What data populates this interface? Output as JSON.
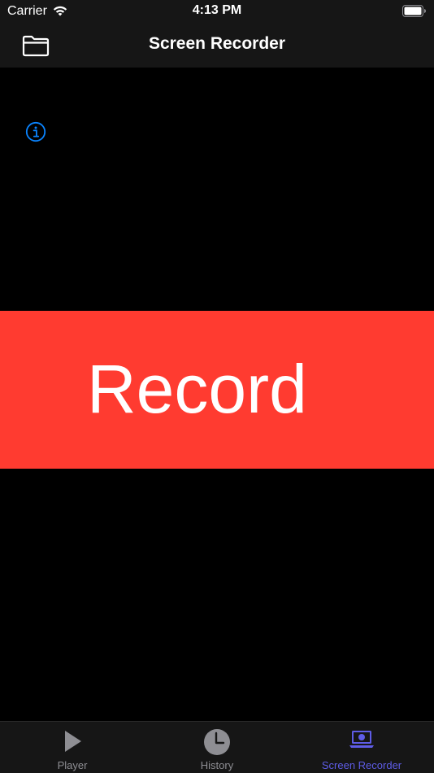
{
  "status_bar": {
    "carrier": "Carrier",
    "time": "4:13 PM"
  },
  "nav": {
    "title": "Screen Recorder"
  },
  "record": {
    "label": "Record",
    "color": "#ff3b30"
  },
  "tabs": [
    {
      "label": "Player",
      "icon": "play-icon",
      "active": false
    },
    {
      "label": "History",
      "icon": "clock-icon",
      "active": false
    },
    {
      "label": "Screen Recorder",
      "icon": "screen-recorder-icon",
      "active": true
    }
  ],
  "colors": {
    "accent": "#5e5ce6",
    "info": "#0a84ff",
    "inactive": "#8e8e93",
    "bar_background": "#161616"
  }
}
